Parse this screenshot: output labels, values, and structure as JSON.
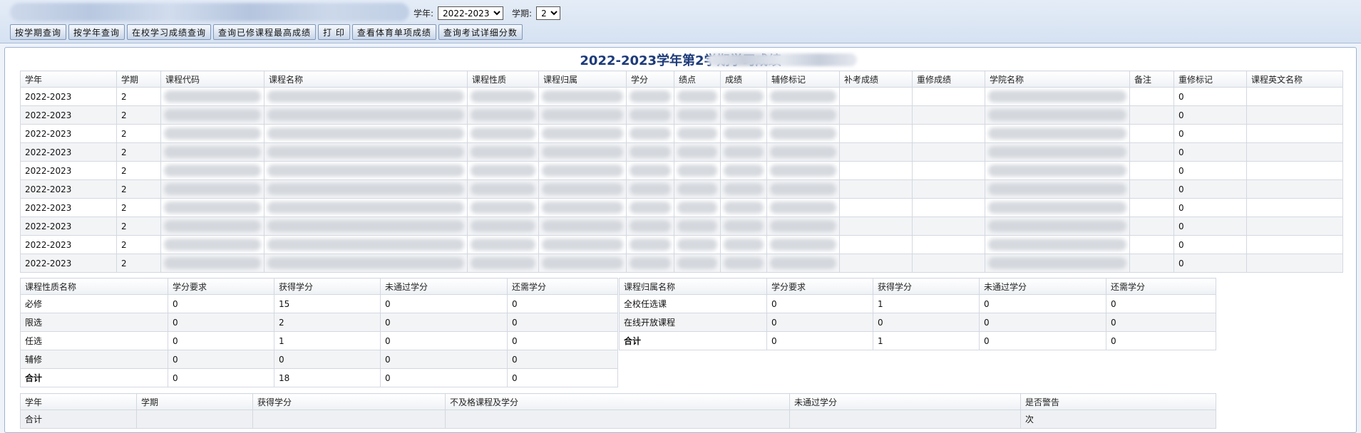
{
  "filters": {
    "year_label": "学年:",
    "year_value": "2022-2023",
    "term_label": "学期:",
    "term_value": "2"
  },
  "toolbar": {
    "btn_term": "按学期查询",
    "btn_year": "按学年查询",
    "btn_school": "在校学习成绩查询",
    "btn_best": "查询已修课程最高成绩",
    "btn_print": "打 印",
    "btn_pe": "查看体育单项成绩",
    "btn_exam": "查询考试详细分数"
  },
  "title": "2022-2023学年第2学期学习成绩",
  "main": {
    "headers": [
      "学年",
      "学期",
      "课程代码",
      "课程名称",
      "课程性质",
      "课程归属",
      "学分",
      "绩点",
      "成绩",
      "辅修标记",
      "补考成绩",
      "重修成绩",
      "学院名称",
      "备注",
      "重修标记",
      "课程英文名称"
    ],
    "rows": [
      {
        "year": "2022-2023",
        "term": "2",
        "retake_flag": "0"
      },
      {
        "year": "2022-2023",
        "term": "2",
        "retake_flag": "0"
      },
      {
        "year": "2022-2023",
        "term": "2",
        "retake_flag": "0"
      },
      {
        "year": "2022-2023",
        "term": "2",
        "retake_flag": "0"
      },
      {
        "year": "2022-2023",
        "term": "2",
        "retake_flag": "0"
      },
      {
        "year": "2022-2023",
        "term": "2",
        "retake_flag": "0"
      },
      {
        "year": "2022-2023",
        "term": "2",
        "retake_flag": "0"
      },
      {
        "year": "2022-2023",
        "term": "2",
        "retake_flag": "0"
      },
      {
        "year": "2022-2023",
        "term": "2",
        "retake_flag": "0"
      },
      {
        "year": "2022-2023",
        "term": "2",
        "retake_flag": "0"
      }
    ]
  },
  "nature": {
    "headers": [
      "课程性质名称",
      "学分要求",
      "获得学分",
      "未通过学分",
      "还需学分"
    ],
    "rows": [
      [
        "必修",
        "0",
        "15",
        "0",
        "0"
      ],
      [
        "限选",
        "0",
        "2",
        "0",
        "0"
      ],
      [
        "任选",
        "0",
        "1",
        "0",
        "0"
      ],
      [
        "辅修",
        "0",
        "0",
        "0",
        "0"
      ],
      [
        "合计",
        "0",
        "18",
        "0",
        "0"
      ]
    ]
  },
  "category": {
    "headers": [
      "课程归属名称",
      "学分要求",
      "获得学分",
      "未通过学分",
      "还需学分"
    ],
    "rows": [
      [
        "全校任选课",
        "0",
        "1",
        "0",
        "0"
      ],
      [
        "在线开放课程",
        "0",
        "0",
        "0",
        "0"
      ],
      [
        "合计",
        "0",
        "1",
        "0",
        "0"
      ]
    ]
  },
  "summary": {
    "headers": [
      "学年",
      "学期",
      "获得学分",
      "不及格课程及学分",
      "未通过学分",
      "是否警告"
    ],
    "row": [
      "合计",
      "",
      "",
      "",
      "",
      "次"
    ]
  }
}
